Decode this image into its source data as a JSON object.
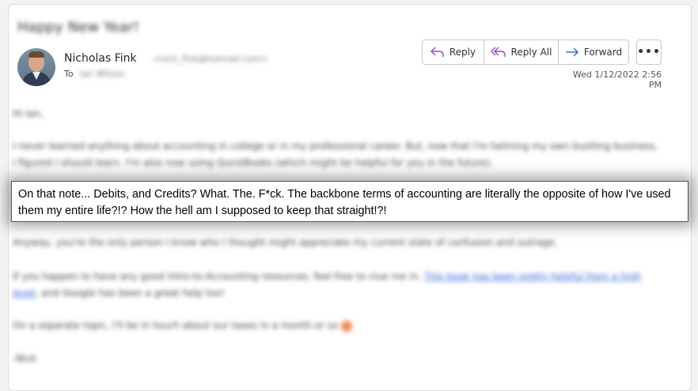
{
  "email": {
    "subject": "Happy New Year!",
    "sender_name": "Nicholas Fink",
    "sender_email": "<nick_fink@hotmail.com>",
    "to_label": "To",
    "to_value": "Ian Wilson",
    "date": "Wed 1/12/2022 2:56 PM"
  },
  "actions": {
    "reply": "Reply",
    "reply_all": "Reply All",
    "forward": "Forward",
    "more": "•••"
  },
  "body": {
    "greeting": "Hi Ian,",
    "para1": "I never learned anything about accounting in college or in my professional career. But, now that I'm helming my own bustling business, I figured I should learn. I'm also now using QuickBooks (which might be helpful for you in the future).",
    "para3": "Anyway, you're the only person I know who I thought might appreciate my current state of confusion and outrage.",
    "para4_before_link": "If you happen to have any good intro-to-Accounting resources, feel free to clue me in.",
    "para4_link": "This book has been pretty helpful from a high level",
    "para4_after_link": ", and Google has been a great help too!",
    "para5": "On a separate topic, I'll be in touch about our taxes in a month or so",
    "signoff": "-Nick"
  },
  "highlight": {
    "text": "On that note... Debits, and Credits? What. The. F*ck. The backbone terms of accounting are literally the opposite of how I've used them my entire life?!? How the hell am I supposed to keep that straight!?!"
  },
  "colors": {
    "reply_icon": "#8c4fc0",
    "forward_icon": "#2b6cc4",
    "link": "#3a5fd6"
  }
}
